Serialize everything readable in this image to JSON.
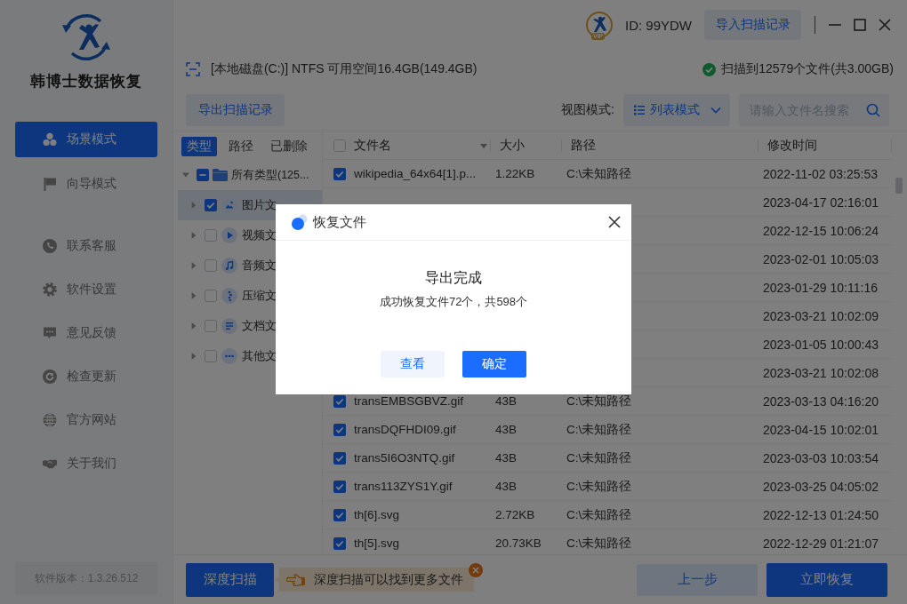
{
  "sidebar": {
    "app_name": "韩博士数据恢复",
    "modes": [
      {
        "label": "场景模式",
        "selected": true
      },
      {
        "label": "向导模式",
        "selected": false
      }
    ],
    "links": [
      {
        "label": "联系客服"
      },
      {
        "label": "软件设置"
      },
      {
        "label": "意见反馈"
      },
      {
        "label": "检查更新"
      },
      {
        "label": "官方网站"
      },
      {
        "label": "关于我们"
      }
    ],
    "version": "软件版本：1.3.26.512"
  },
  "header": {
    "vip_badge": "VIP",
    "user_id": "ID: 99YDW",
    "import_button": "导入扫描记录"
  },
  "disk_bar": {
    "disk_info": "[本地磁盘(C:)] NTFS 可用空间16.4GB(149.4GB)",
    "scan_status": "扫描到12579个文件(共3.00GB)"
  },
  "toolbar": {
    "export_button": "导出扫描记录",
    "view_label": "视图模式:",
    "view_mode": "列表模式",
    "search": {
      "placeholder": "请输入文件名搜索"
    }
  },
  "filter_tabs": [
    {
      "label": "类型",
      "selected": true
    },
    {
      "label": "路径",
      "selected": false
    },
    {
      "label": "已删除",
      "selected": false
    }
  ],
  "tree": {
    "label": "所有类型(125...",
    "checked": false,
    "indeterminate": true,
    "expanded": true,
    "selected": false,
    "children": [
      {
        "kind": "image",
        "label": "图片文",
        "checked": true,
        "selected": true,
        "expanded": false
      },
      {
        "kind": "video",
        "label": "视频文",
        "checked": false,
        "selected": false,
        "expanded": false
      },
      {
        "kind": "audio",
        "label": "音频文",
        "checked": false,
        "selected": false,
        "expanded": false
      },
      {
        "kind": "archive",
        "label": "压缩文",
        "checked": false,
        "selected": false,
        "expanded": false
      },
      {
        "kind": "document",
        "label": "文档文",
        "checked": false,
        "selected": false,
        "expanded": false
      },
      {
        "kind": "other",
        "label": "其他文",
        "checked": false,
        "selected": false,
        "expanded": false
      }
    ]
  },
  "table": {
    "select_all": false,
    "columns": [
      "文件名",
      "大小",
      "路径",
      "修改时间"
    ],
    "rows": [
      {
        "checked": true,
        "name": "wikipedia_64x64[1].p...",
        "size": "1.22KB",
        "path": "C:\\未知路径",
        "time": "2022-11-02 03:25:53"
      },
      {
        "time": "2023-04-17 02:16:01"
      },
      {
        "time": "2022-12-15 10:06:24"
      },
      {
        "time": "2023-02-01 10:05:03"
      },
      {
        "time": "2023-01-29 10:11:16"
      },
      {
        "time": "2023-03-21 10:02:09"
      },
      {
        "time": "2023-01-05 10:00:43"
      },
      {
        "time": "2023-03-21 10:02:08"
      },
      {
        "checked": true,
        "name": "transEMBSGBVZ.gif",
        "size": "43B",
        "path": "C:\\未知路径",
        "time": "2023-03-13 04:16:20"
      },
      {
        "checked": true,
        "name": "transDQFHDI09.gif",
        "size": "43B",
        "path": "C:\\未知路径",
        "time": "2023-04-15 10:02:01"
      },
      {
        "checked": true,
        "name": "trans5I6O3NTQ.gif",
        "size": "43B",
        "path": "C:\\未知路径",
        "time": "2023-03-03 10:03:54"
      },
      {
        "checked": true,
        "name": "trans113ZYS1Y.gif",
        "size": "43B",
        "path": "C:\\未知路径",
        "time": "2023-03-25 04:05:02"
      },
      {
        "checked": true,
        "name": "th[6].svg",
        "size": "2.72KB",
        "path": "C:\\未知路径",
        "time": "2022-12-13 01:24:50"
      },
      {
        "checked": true,
        "name": "th[5].svg",
        "size": "20.73KB",
        "path": "C:\\未知路径",
        "time": "2022-12-29 01:21:07"
      }
    ]
  },
  "bottom_bar": {
    "deep_scan_button": "深度扫描",
    "tip": "深度扫描可以找到更多文件",
    "back_button": "上一步",
    "recover_button": "立即恢复"
  },
  "dialog": {
    "title": "恢复文件",
    "heading": "导出完成",
    "message": "成功恢复文件72个，共598个",
    "buttons": [
      {
        "label": "查看",
        "kind": "secondary"
      },
      {
        "label": "确定",
        "kind": "primary"
      }
    ]
  }
}
